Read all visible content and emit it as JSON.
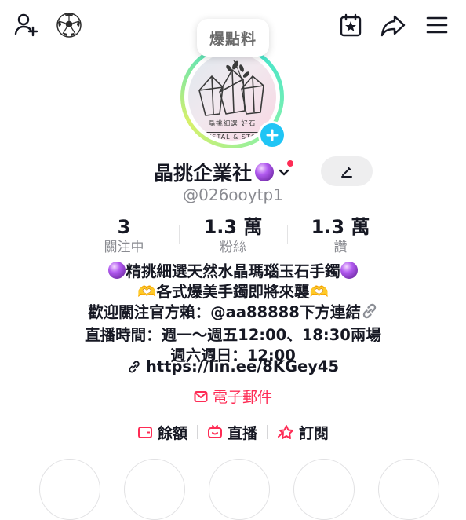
{
  "header": {
    "add_friend_icon": "person-plus-icon",
    "soccer_icon": "soccer-ball-icon",
    "calendar_icon": "calendar-star-icon",
    "share_icon": "share-arrow-icon",
    "menu_icon": "hamburger-menu-icon"
  },
  "profile": {
    "hot_bubble": "爆點料",
    "avatar_text_cn": "晶挑細選 好石",
    "avatar_text_en": "CRYSTAL & STONE",
    "name": "晶挑企業社",
    "handle": "@026ooytp1"
  },
  "stats": [
    {
      "value": "3",
      "label": "關注中"
    },
    {
      "value": "1.3 萬",
      "label": "粉絲"
    },
    {
      "value": "1.3 萬",
      "label": "讚"
    }
  ],
  "bio": [
    "精挑細選天然水晶瑪瑙玉石手鐲",
    "各式爆美手鐲即將來襲",
    "歡迎關注官方賴：@aa88888下方連結",
    "直播時間：週一～週五12:00、18:30兩場",
    "週六週日：12:00"
  ],
  "link": "https://lin.ee/8KGey45",
  "email_label": "電子郵件",
  "actions": [
    {
      "label": "餘額",
      "icon": "wallet-icon"
    },
    {
      "label": "直播",
      "icon": "live-tv-icon"
    },
    {
      "label": "訂閱",
      "icon": "subscribe-icon"
    }
  ],
  "colors": {
    "accent_red": "#fe2c55",
    "plus_badge": "#20c5f5",
    "text": "#161823",
    "secondary_text": "#8a8b91"
  }
}
